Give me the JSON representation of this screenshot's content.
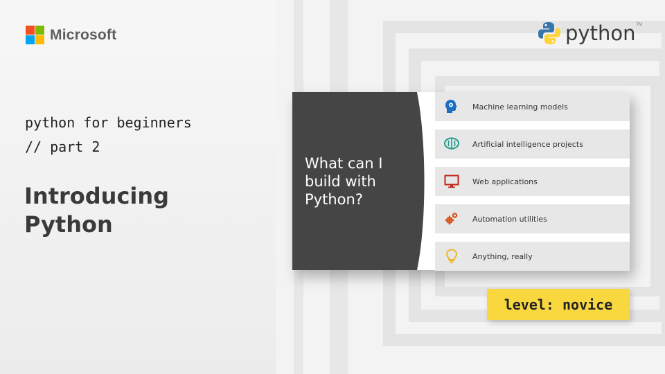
{
  "brand": {
    "microsoft_label": "Microsoft",
    "python_label": "python",
    "python_tm": "TM"
  },
  "series": {
    "line1": "python for beginners",
    "line2": "// part 2"
  },
  "title": {
    "line1": "Introducing",
    "line2": "Python"
  },
  "slide": {
    "heading_lines": [
      "What can I",
      "build with",
      "Python?"
    ],
    "items": [
      {
        "label": "Machine learning models",
        "icon": "head-gear-icon"
      },
      {
        "label": "Artificial intelligence projects",
        "icon": "brain-icon"
      },
      {
        "label": "Web applications",
        "icon": "monitor-icon"
      },
      {
        "label": "Automation utilities",
        "icon": "gears-icon"
      },
      {
        "label": "Anything, really",
        "icon": "lightbulb-icon"
      }
    ]
  },
  "level_badge": "level: novice",
  "colors": {
    "ms_red": "#f25022",
    "ms_green": "#7fba00",
    "ms_blue": "#00a4ef",
    "ms_yellow": "#ffb900",
    "slide_dark": "#454545",
    "badge_yellow": "#f9d83f",
    "icon_blue": "#1b6ec2",
    "icon_teal": "#1a9c8c",
    "icon_red": "#c0261a",
    "icon_orange": "#d9541e",
    "icon_yellow": "#e8b420"
  }
}
